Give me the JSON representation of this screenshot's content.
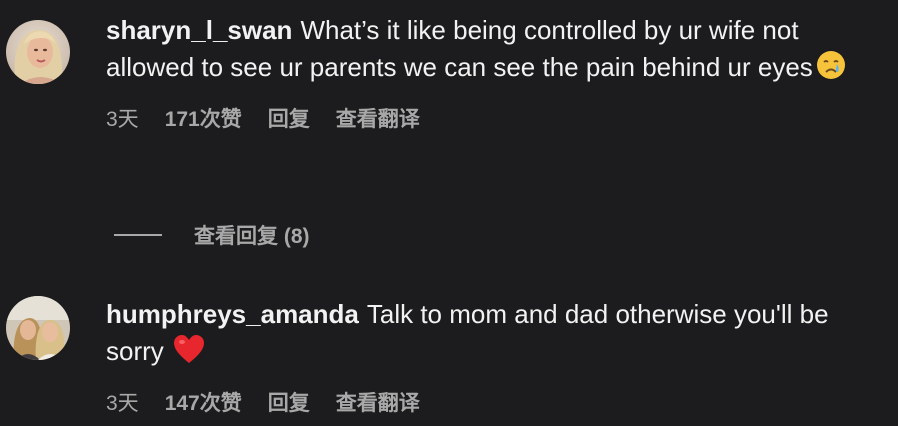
{
  "comments": [
    {
      "username": "sharyn_l_swan",
      "text": "What’s it like being controlled by ur wife not allowed to see ur parents we can see the pain behind ur eyes",
      "emoji": "crying-face-icon",
      "time": "3天",
      "likes": "171次赞",
      "reply_label": "回复",
      "translate_label": "查看翻译",
      "view_replies_label": "查看回复 (8)"
    },
    {
      "username": "humphreys_amanda",
      "text": "Talk to mom and dad otherwise you'll be sorry",
      "emoji": "red-heart-icon",
      "time": "3天",
      "likes": "147次赞",
      "reply_label": "回复",
      "translate_label": "查看翻译"
    }
  ],
  "colors": {
    "background": "#1c1c1e",
    "text": "#f2f2f2",
    "secondary": "#a8a8a8"
  }
}
